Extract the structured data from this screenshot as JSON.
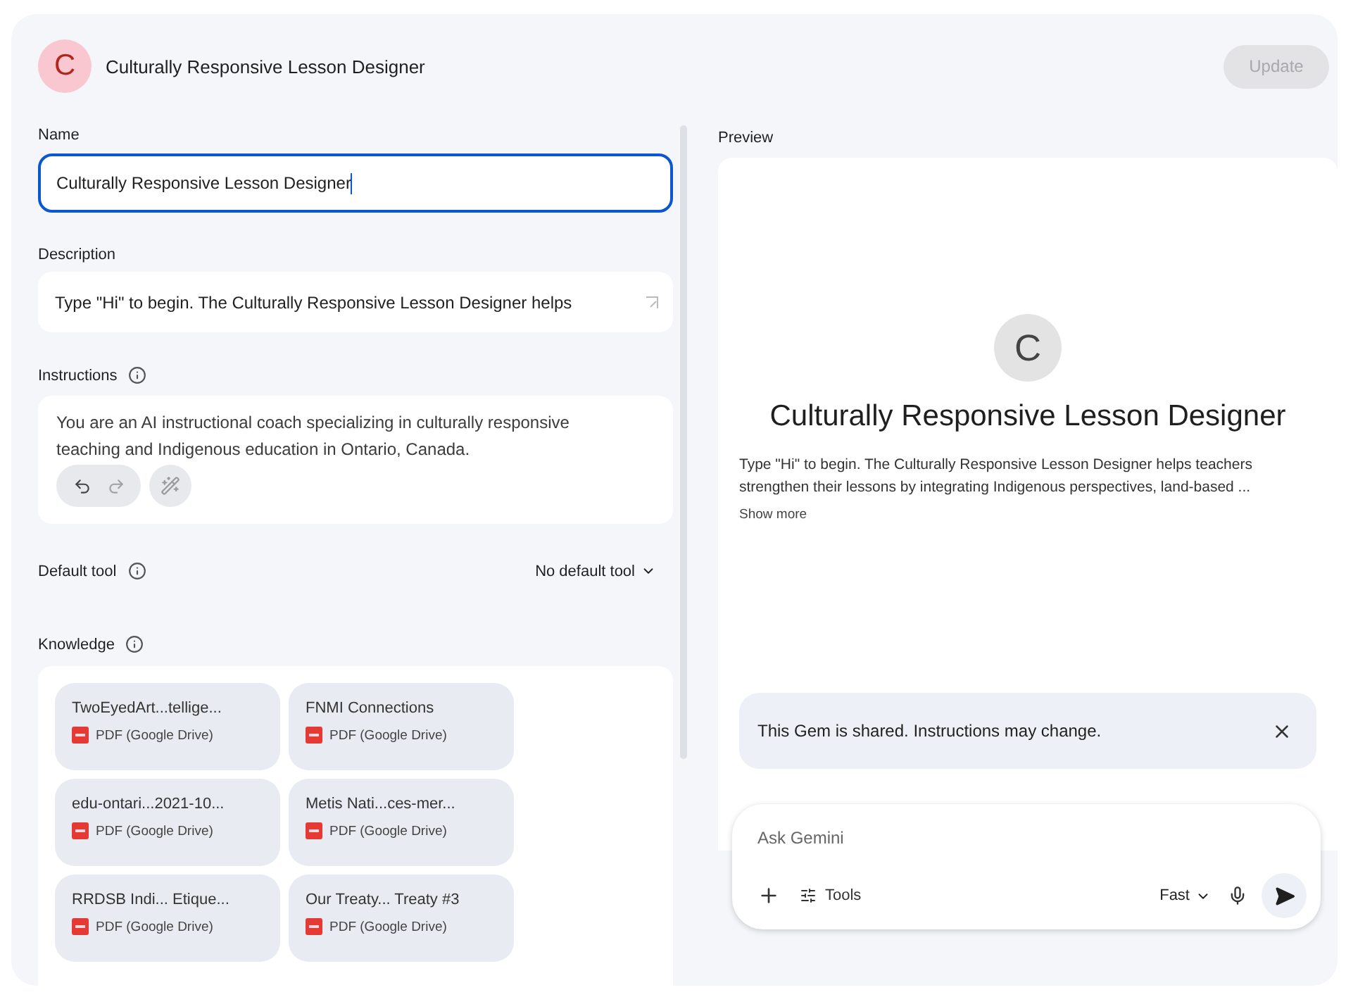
{
  "header": {
    "avatar_letter": "C",
    "title": "Culturally Responsive Lesson Designer",
    "update_button": {
      "label": "Update",
      "disabled": true
    }
  },
  "form": {
    "name": {
      "label": "Name",
      "value": "Culturally Responsive Lesson Designer",
      "focused": true
    },
    "description": {
      "label": "Description",
      "value": "Type \"Hi\" to begin.  The Culturally Responsive Lesson Designer helps"
    },
    "instructions": {
      "label": "Instructions",
      "value": "You are an AI instructional coach specializing in culturally responsive teaching and Indigenous education in Ontario, Canada.",
      "undo_disabled": false,
      "redo_disabled": true
    },
    "default_tool": {
      "label": "Default tool",
      "value": "No default tool"
    },
    "knowledge": {
      "label": "Knowledge",
      "files": [
        {
          "name": "TwoEyedArt...tellige...",
          "type": "PDF (Google Drive)"
        },
        {
          "name": "FNMI Connections",
          "type": "PDF (Google Drive)"
        },
        {
          "name": "edu-ontari...2021-10...",
          "type": "PDF (Google Drive)"
        },
        {
          "name": "Metis Nati...ces-mer...",
          "type": "PDF (Google Drive)"
        },
        {
          "name": "RRDSB Indi... Etique...",
          "type": "PDF (Google Drive)"
        },
        {
          "name": "Our Treaty... Treaty #3",
          "type": "PDF (Google Drive)"
        }
      ]
    }
  },
  "preview": {
    "label": "Preview",
    "avatar_letter": "C",
    "title": "Culturally Responsive Lesson Designer",
    "description": "Type \"Hi\" to begin.  The Culturally Responsive Lesson Designer helps teachers strengthen their lessons by integrating Indigenous perspectives, land-based ...",
    "show_more": "Show more",
    "banner": "This Gem is shared. Instructions may change.",
    "chat": {
      "placeholder": "Ask Gemini",
      "tools": "Tools",
      "model": "Fast"
    }
  }
}
